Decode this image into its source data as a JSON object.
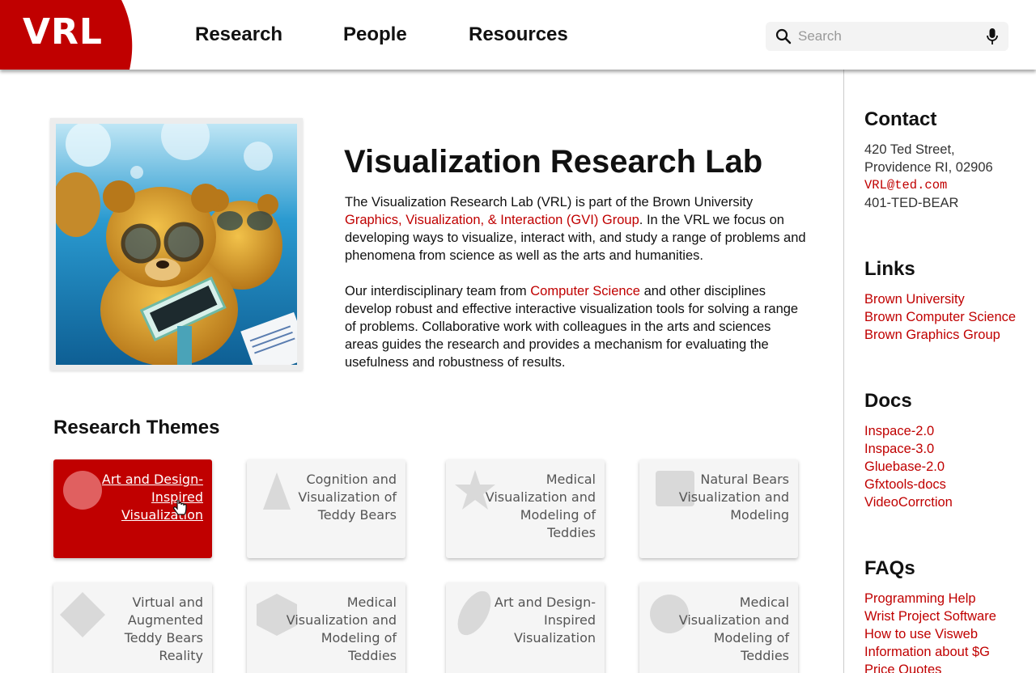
{
  "header": {
    "logo": "VRL",
    "nav": [
      {
        "label": "Research"
      },
      {
        "label": "People"
      },
      {
        "label": "Resources"
      }
    ],
    "search": {
      "placeholder": "Search",
      "value": ""
    }
  },
  "hero": {
    "title": "Visualization Research Lab",
    "p1_a": "The Visualization Research Lab (VRL) is part of the Brown University ",
    "p1_link": "Graphics, Visualization, & Interaction (GVI) Group",
    "p1_b": ". In the VRL we focus on developing ways to visualize, interact with, and study a range of problems and phenomena from science as well as the arts and humanities.",
    "p2_a": "Our interdisciplinary team from ",
    "p2_link": "Computer Science",
    "p2_b": " and other disciplines develop robust and effective interactive visualization tools for solving a range of problems. Collaborative work with colleagues in the arts and sciences areas guides the research and provides a mechanism for evaluating the usefulness and robustness of results."
  },
  "themes": {
    "heading": "Research Themes",
    "cards": [
      {
        "label": "Art and Design-Inspired Visualization",
        "shape": "circle-icon"
      },
      {
        "label": "Cognition and Visualization of Teddy Bears",
        "shape": "triangle-icon"
      },
      {
        "label": "Medical Visualization and Modeling of Teddies",
        "shape": "star-icon"
      },
      {
        "label": "Natural Bears Visualization and Modeling",
        "shape": "square-icon"
      },
      {
        "label": "Virtual and Augmented Teddy Bears Reality",
        "shape": "diamond-icon"
      },
      {
        "label": "Medical Visualization and Modeling of Teddies",
        "shape": "hexagon-icon"
      },
      {
        "label": "Art and Design-Inspired Visualization",
        "shape": "ellipse-icon"
      },
      {
        "label": "Medical Visualization and Modeling of Teddies",
        "shape": "circle-icon"
      }
    ]
  },
  "sidebar": {
    "contact": {
      "heading": "Contact",
      "address1": "420 Ted Street,",
      "address2": "Providence RI, 02906",
      "email": "VRL@ted.com",
      "phone": "401-TED-BEAR"
    },
    "links": {
      "heading": "Links",
      "items": [
        "Brown University",
        "Brown Computer Science",
        "Brown Graphics Group"
      ]
    },
    "docs": {
      "heading": "Docs",
      "items": [
        "Inspace-2.0",
        "Inspace-3.0",
        "Gluebase-2.0",
        "Gfxtools-docs",
        "VideoCorrction"
      ]
    },
    "faqs": {
      "heading": "FAQs",
      "items": [
        "Programming Help",
        "Wrist Project Software",
        "How to use Visweb",
        "Information about $G",
        "Price Quotes"
      ]
    }
  },
  "colors": {
    "brand": "#c00000",
    "card": "#f5f5f5",
    "shape": "#d9d9d9"
  }
}
